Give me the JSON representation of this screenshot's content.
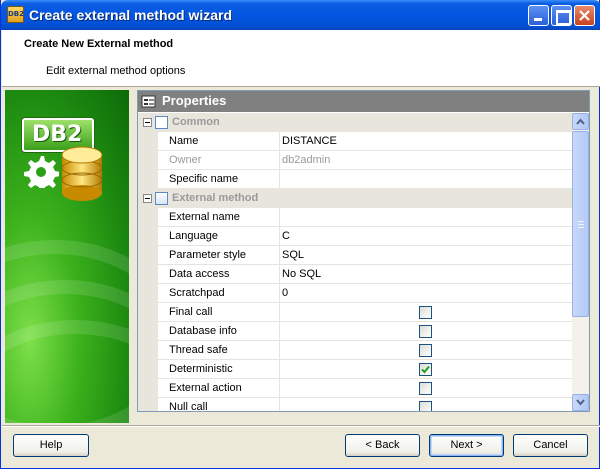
{
  "window": {
    "icon_text": "DB2",
    "title": "Create external method wizard",
    "title_icon_color": "#ffd966"
  },
  "header": {
    "title": "Create New External method",
    "subtitle": "Edit external method options"
  },
  "side_panel": {
    "logo_text": "DB2",
    "accent_color": "#3cb21c"
  },
  "properties": {
    "header": "Properties",
    "categories": {
      "common": "Common",
      "external": "External method"
    },
    "common_rows": [
      {
        "name": "Name",
        "value": "DISTANCE"
      },
      {
        "name": "Owner",
        "value": "db2admin"
      },
      {
        "name": "Specific name",
        "value": ""
      }
    ],
    "external_rows": [
      {
        "name": "External name",
        "value": ""
      },
      {
        "name": "Language",
        "value": "C"
      },
      {
        "name": "Parameter style",
        "value": "SQL"
      },
      {
        "name": "Data access",
        "value": "No SQL"
      },
      {
        "name": "Scratchpad",
        "value": "0"
      }
    ],
    "checkbox_rows": [
      {
        "name": "Final call",
        "checked": false
      },
      {
        "name": "Database info",
        "checked": false
      },
      {
        "name": "Thread safe",
        "checked": false
      },
      {
        "name": "Deterministic",
        "checked": true
      },
      {
        "name": "External action",
        "checked": false
      },
      {
        "name": "Null call",
        "checked": false
      }
    ]
  },
  "buttons": {
    "help": "Help",
    "back": "< Back",
    "next": "Next >",
    "cancel": "Cancel"
  }
}
